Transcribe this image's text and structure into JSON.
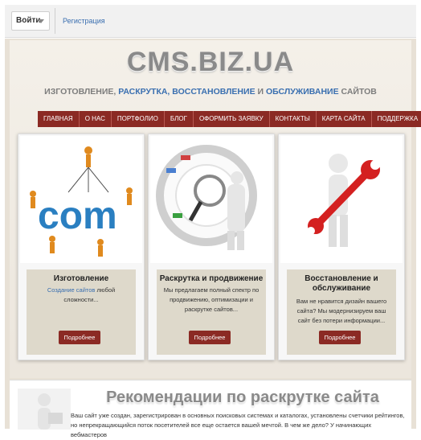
{
  "topbar": {
    "login_label": "Войти",
    "register_label": "Регистрация"
  },
  "header": {
    "logo": "CMS.BIZ.UA",
    "tagline": {
      "part1": "ИЗГОТОВЛЕНИЕ, ",
      "part2": "РАСКРУТКА, ВОССТАНОВЛЕНИЕ",
      "part3": " И ",
      "part4": "ОБСЛУЖИВАНИЕ",
      "part5": " САЙТОВ"
    }
  },
  "nav": {
    "items": [
      "ГЛАВНАЯ",
      "О НАС",
      "ПОРТФОЛИО",
      "БЛОГ",
      "ОФОРМИТЬ ЗАЯВКУ",
      "КОНТАКТЫ",
      "КАРТА САЙТА",
      "ПОДДЕРЖКА"
    ]
  },
  "cards": [
    {
      "title": "Изготовление",
      "link": "Создание сайтов",
      "text": " любой сложности...",
      "button": "Подробнее",
      "art_label": "com"
    },
    {
      "title": "Раскрутка и продвижение",
      "text": "Мы предлагаем полный спектр по продвижению, оптимизации и раскрутке сайтов...",
      "button": "Подробнее"
    },
    {
      "title": "Восстановление и обслуживание",
      "text": "Вам не нравится дизайн вашего сайта? Мы модернизируем ваш сайт без потери информации...",
      "button": "Подробнее"
    }
  ],
  "recommend": {
    "title": "Рекомендации по раскрутке сайта",
    "text": "Ваш сайт уже создан, зарегистрирован в основных поисковых системах и каталогах, установлены счетчики рейтингов, но непрекращающийся поток посетителей все еще остается вашей мечтой. В чем же дело? У начинающих вебмастеров"
  },
  "colors": {
    "accent": "#8b2a24",
    "link": "#3a6fb0",
    "logo_gray": "#8a8a8a"
  }
}
